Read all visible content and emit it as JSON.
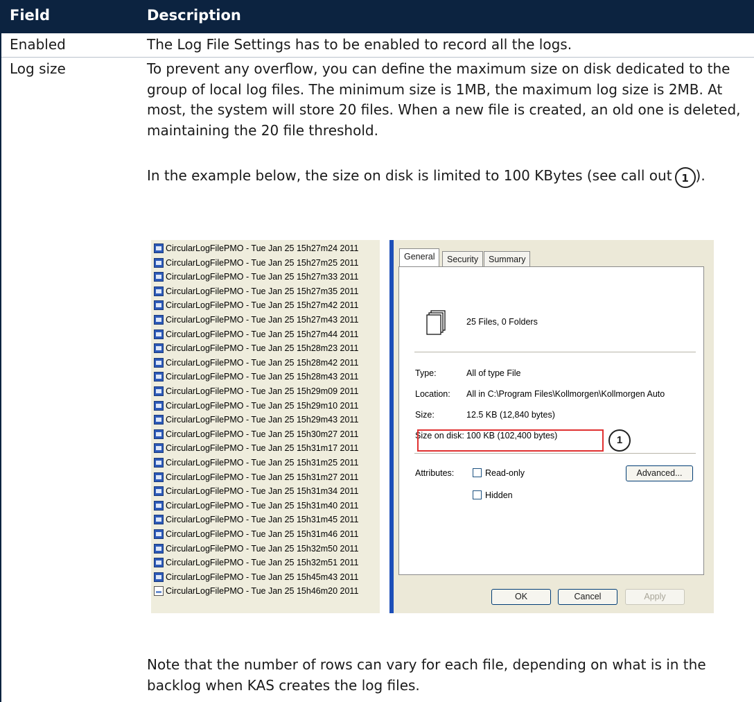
{
  "table": {
    "headers": {
      "field": "Field",
      "description": "Description"
    },
    "rows": [
      {
        "field": "Enabled",
        "description": "The Log File Settings has to be enabled to record all the logs."
      },
      {
        "field": "Log size",
        "paragraphs": [
          "To prevent any overflow, you can define the maximum size on disk dedicated to the group of local log files. The minimum size is 1MB, the maximum log size is 2MB. At most, the system will store 20 files. When a new file is created, an old one is deleted, maintaining the 20 file threshold.",
          "In the example below, the size on disk is limited to 100 KBytes (see call out",
          ").",
          "Note that the number of rows can vary for each file, depending on what is in the backlog when KAS creates the log files."
        ],
        "callout_number": "1"
      }
    ]
  },
  "screenshot": {
    "files": [
      "CircularLogFilePMO - Tue Jan 25 15h27m24 2011",
      "CircularLogFilePMO - Tue Jan 25 15h27m25 2011",
      "CircularLogFilePMO - Tue Jan 25 15h27m33 2011",
      "CircularLogFilePMO - Tue Jan 25 15h27m35 2011",
      "CircularLogFilePMO - Tue Jan 25 15h27m42 2011",
      "CircularLogFilePMO - Tue Jan 25 15h27m43 2011",
      "CircularLogFilePMO - Tue Jan 25 15h27m44 2011",
      "CircularLogFilePMO - Tue Jan 25 15h28m23 2011",
      "CircularLogFilePMO - Tue Jan 25 15h28m42 2011",
      "CircularLogFilePMO - Tue Jan 25 15h28m43 2011",
      "CircularLogFilePMO - Tue Jan 25 15h29m09 2011",
      "CircularLogFilePMO - Tue Jan 25 15h29m10 2011",
      "CircularLogFilePMO - Tue Jan 25 15h29m43 2011",
      "CircularLogFilePMO - Tue Jan 25 15h30m27 2011",
      "CircularLogFilePMO - Tue Jan 25 15h31m17 2011",
      "CircularLogFilePMO - Tue Jan 25 15h31m25 2011",
      "CircularLogFilePMO - Tue Jan 25 15h31m27 2011",
      "CircularLogFilePMO - Tue Jan 25 15h31m34 2011",
      "CircularLogFilePMO - Tue Jan 25 15h31m40 2011",
      "CircularLogFilePMO - Tue Jan 25 15h31m45 2011",
      "CircularLogFilePMO - Tue Jan 25 15h31m46 2011",
      "CircularLogFilePMO - Tue Jan 25 15h32m50 2011",
      "CircularLogFilePMO - Tue Jan 25 15h32m51 2011",
      "CircularLogFilePMO - Tue Jan 25 15h45m43 2011",
      "CircularLogFilePMO - Tue Jan 25 15h46m20 2011"
    ],
    "dialog": {
      "tabs": [
        "General",
        "Security",
        "Summary"
      ],
      "summary": "25 Files, 0 Folders",
      "type_label": "Type:",
      "type_value": "All of type File",
      "location_label": "Location:",
      "location_value": "All in C:\\Program Files\\Kollmorgen\\Kollmorgen Auto",
      "size_label": "Size:",
      "size_value": "12.5 KB (12,840 bytes)",
      "size_on_disk_label": "Size on disk:",
      "size_on_disk_value": "100 KB (102,400 bytes)",
      "callout": "1",
      "attributes_label": "Attributes:",
      "readonly_label": "Read-only",
      "hidden_label": "Hidden",
      "advanced_button": "Advanced...",
      "ok_button": "OK",
      "cancel_button": "Cancel",
      "apply_button": "Apply"
    }
  }
}
